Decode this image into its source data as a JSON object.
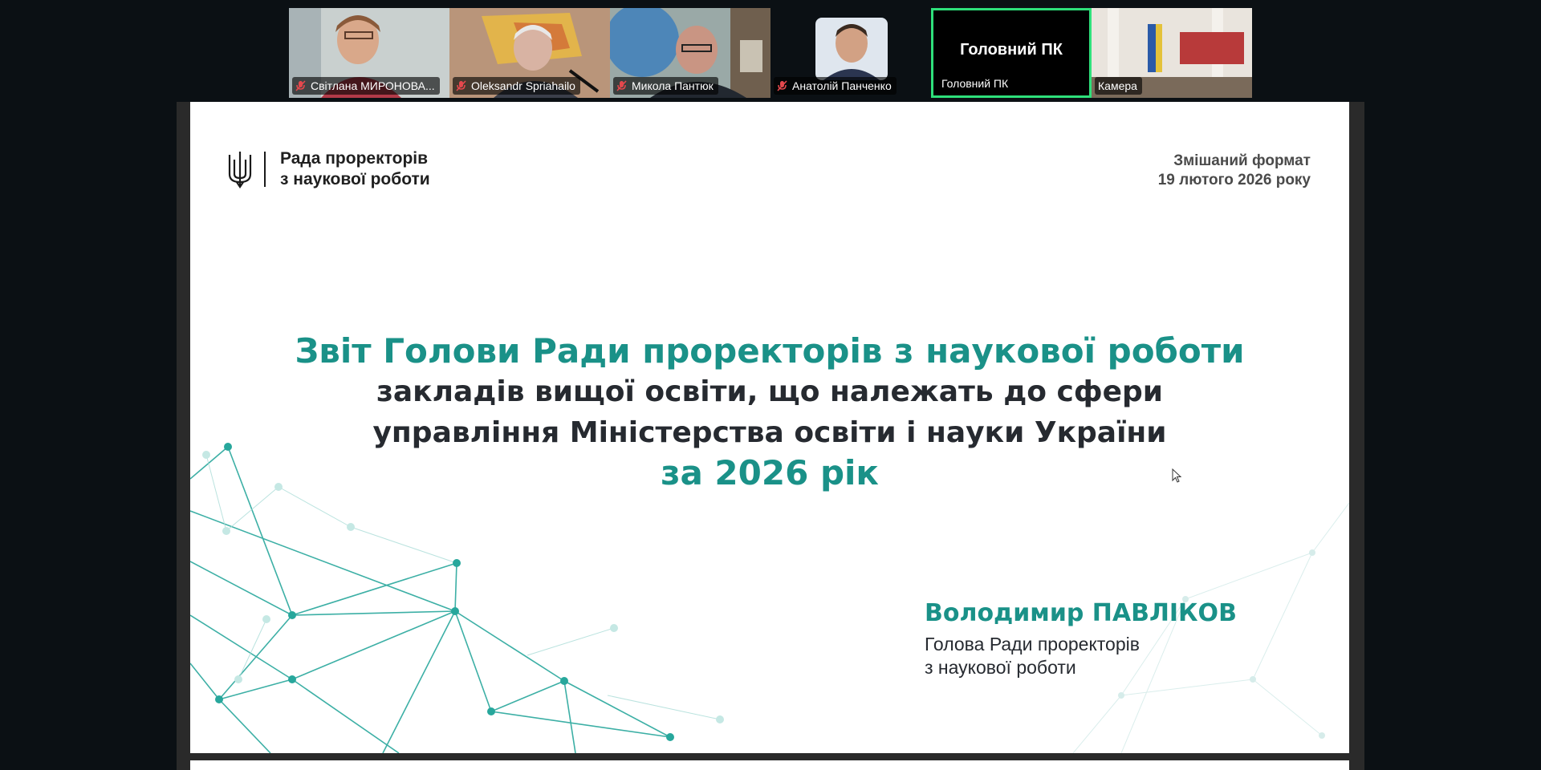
{
  "participants": [
    {
      "name": "Світлана МИРОНОВА...",
      "muted": true
    },
    {
      "name": "Oleksandr Spriahailo",
      "muted": true
    },
    {
      "name": "Микола Пантюк",
      "muted": true
    },
    {
      "name": "Анатолій Панченко",
      "muted": true
    },
    {
      "name": "Головний ПК",
      "muted": false,
      "label": "Головний ПК",
      "active": true
    },
    {
      "name": "Камера",
      "muted": false
    }
  ],
  "slide": {
    "org_line1": "Рада проректорів",
    "org_line2": "з наукової роботи",
    "meta_line1": "Змішаний формат",
    "meta_line2": "19 лютого 2026 року",
    "title_line1": "Звіт Голови Ради проректорів з наукової роботи",
    "title_line2": "закладів вищої освіти, що належать до сфери",
    "title_line3": "управління Міністерства освіти і науки України",
    "title_line4": "за 2026 рік",
    "speaker_name": "Володимир ПАВЛІКОВ",
    "speaker_role_line1": "Голова Ради проректорів",
    "speaker_role_line2": "з наукової роботи"
  },
  "colors": {
    "accent": "#1a9188",
    "active_border": "#2ee07a",
    "mic_muted": "#e5484d"
  },
  "icons": {
    "mic": "mic-muted-icon",
    "trident": "trident-icon",
    "cursor": "mouse-cursor-icon"
  }
}
